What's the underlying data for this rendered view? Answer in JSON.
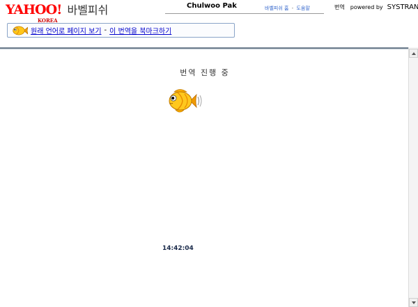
{
  "header": {
    "logo": {
      "yahoo": "YAHOO!",
      "korea": "KOREA",
      "service": "바벨피쉬"
    },
    "user_name": "Chulwoo Pak",
    "toplinks": {
      "home": "바벨피쉬 홈",
      "separator": "-",
      "help": "도움말"
    },
    "powered": {
      "label": "번역",
      "by": "powered by",
      "brand": "SYSTRAN"
    }
  },
  "linkbox": {
    "view_original": "원래 언어로 페이지 보기",
    "separator": "-",
    "bookmark": "이 번역을 북마크하기"
  },
  "content": {
    "status_text": "번역 진행 중",
    "clock": "14:42:04"
  },
  "colors": {
    "yahoo_red": "#ff0000",
    "link_blue": "#0000cc",
    "frame_line": "#6c7c8c",
    "box_border": "#8aa4c8"
  },
  "icons": {
    "small": "babelfish-fish-icon",
    "large": "babelfish-fish-icon"
  }
}
